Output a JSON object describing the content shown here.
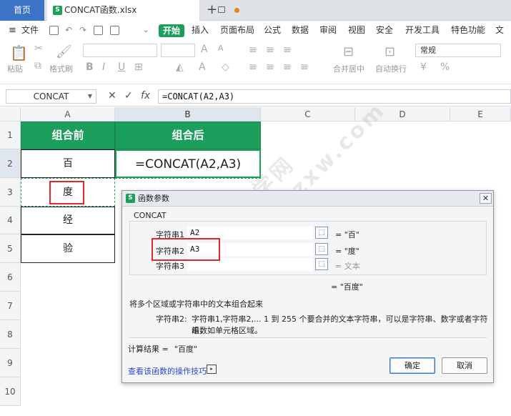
{
  "tabs": {
    "home": "首页",
    "doc_title": "CONCAT函数.xlsx"
  },
  "menu": {
    "file": "文件",
    "items": [
      "开始",
      "插入",
      "页面布局",
      "公式",
      "数据",
      "审阅",
      "视图",
      "安全",
      "开发工具",
      "特色功能",
      "文档"
    ]
  },
  "ribbon": {
    "paste": "粘贴",
    "format_painter": "格式刷",
    "font_size": "A",
    "merge": "合并居中",
    "wrap": "自动换行",
    "number_format": "常规"
  },
  "formula_bar": {
    "name_box": "CONCAT",
    "fx": "fx",
    "formula": "=CONCAT(A2,A3)"
  },
  "grid": {
    "columns": [
      "A",
      "B",
      "C",
      "D",
      "E"
    ],
    "rows": [
      "1",
      "2",
      "3",
      "4",
      "5",
      "6",
      "7",
      "8",
      "9",
      "10"
    ],
    "a1": "组合前",
    "b1": "组合后",
    "a2": "百",
    "a3": "度",
    "a4": "经",
    "a5": "验",
    "b2": "=CONCAT(A2,A3)"
  },
  "dialog": {
    "title": "函数参数",
    "function_name": "CONCAT",
    "args": [
      {
        "label": "字符串1",
        "value": "A2",
        "result": "= \"百\""
      },
      {
        "label": "字符串2",
        "value": "A3",
        "result": "= \"度\""
      },
      {
        "label": "字符串3",
        "value": "",
        "result": "= 文本"
      }
    ],
    "total_result": "= \"百度\"",
    "description": "将多个区域或字符串中的文本组合起来",
    "param_name": "字符串2:",
    "param_desc_line1": "字符串1,字符串2,... 1 到 255 个要合并的文本字符串，可以是字符串、数字或者字符串数",
    "param_desc_line2": "组，如单元格区域。",
    "calc_label": "计算结果 = ",
    "calc_value": "\"百度\"",
    "help_link": "查看该函数的操作技巧",
    "ok": "确定",
    "cancel": "取消"
  },
  "watermark": "软件自学网 www.rjzxw.com",
  "colors": {
    "accent_green": "#1c9e5c",
    "tab_blue": "#3b74c6",
    "highlight_red": "#e3262b"
  }
}
